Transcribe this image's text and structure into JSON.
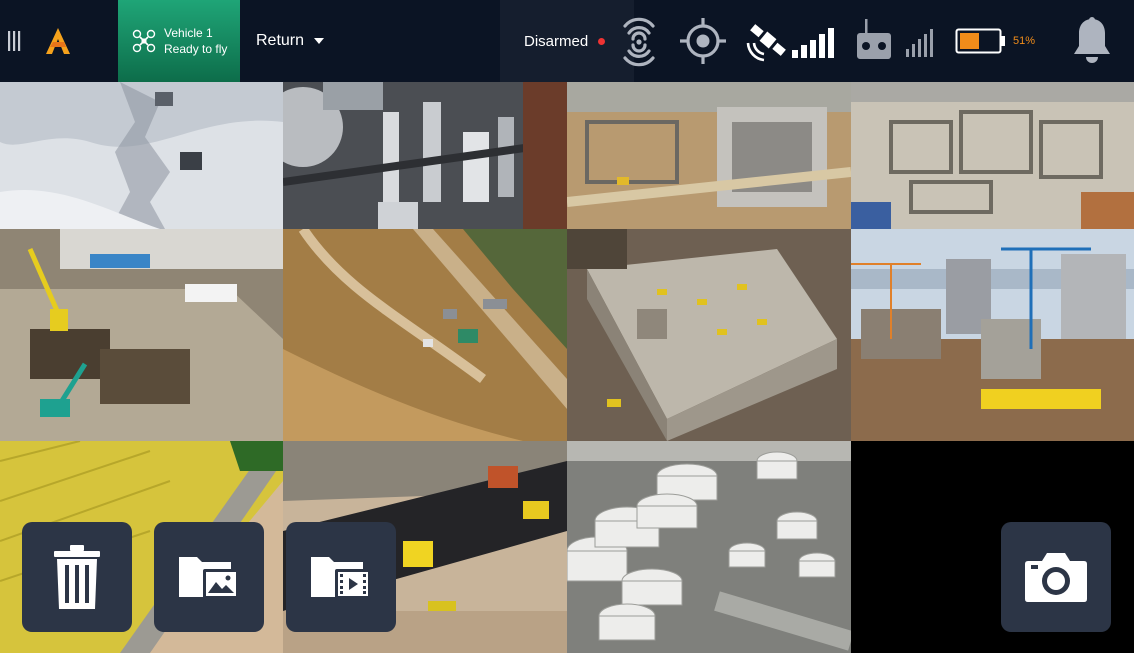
{
  "header": {
    "vehicle_name": "Vehicle 1",
    "vehicle_status": "Ready to fly",
    "flight_mode": "Return",
    "arm_status": "Disarmed",
    "battery_percent": "51%",
    "battery_level": 0.51
  },
  "colors": {
    "topbar": "#0b1424",
    "vehicle_green": "#1fa577",
    "accent_orange": "#f08c1a",
    "arm_red": "#e33333",
    "button_bg": "#2c3546"
  },
  "icons": {
    "menu": "menu-icon",
    "logo": "app-logo-icon",
    "drone": "drone-icon",
    "signal": "signal-broadcast-icon",
    "gps_target": "crosshair-icon",
    "satellite": "satellite-icon",
    "rc": "remote-controller-icon",
    "bell": "bell-icon",
    "trash": "trash-icon",
    "photo_folder": "photo-folder-icon",
    "video_folder": "video-folder-icon",
    "camera": "camera-icon"
  },
  "gallery": [
    {
      "label": "snow-aerial"
    },
    {
      "label": "refinery-towers"
    },
    {
      "label": "construction-site-foundation"
    },
    {
      "label": "concrete-foundation-grid"
    },
    {
      "label": "excavation-pit-crane"
    },
    {
      "label": "dirt-earthworks"
    },
    {
      "label": "concrete-building-frame"
    },
    {
      "label": "highrise-construction"
    },
    {
      "label": "rapeseed-field-road"
    },
    {
      "label": "road-paving"
    },
    {
      "label": "storage-tanks"
    },
    {
      "label": "empty"
    }
  ]
}
